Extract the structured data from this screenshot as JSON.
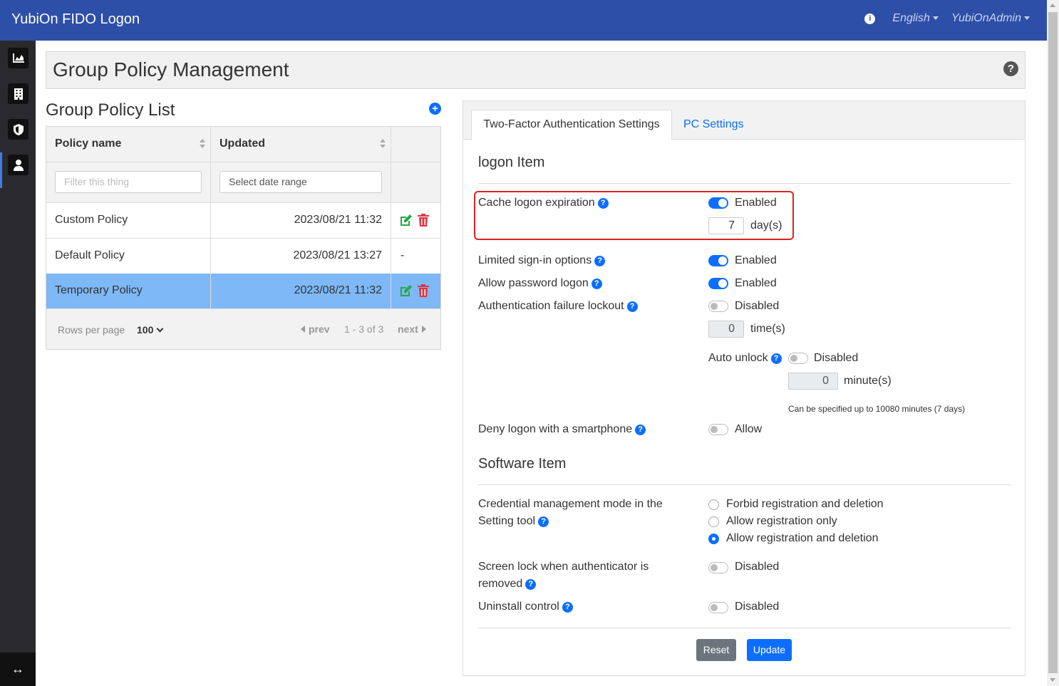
{
  "app": {
    "title": "YubiOn FIDO Logon",
    "info_icon": "info-icon",
    "language": "English",
    "user": "YubiOnAdmin"
  },
  "sidebar": {
    "items": [
      {
        "icon": "chart-icon"
      },
      {
        "icon": "building-icon"
      },
      {
        "icon": "shield-icon",
        "active": true
      },
      {
        "icon": "user-icon"
      }
    ],
    "toggle_icon": "expand-arrows-icon"
  },
  "page": {
    "title": "Group Policy Management",
    "help": "?"
  },
  "list": {
    "title": "Group Policy List",
    "add_icon": "+",
    "columns": [
      "Policy name",
      "Updated"
    ],
    "filter_name_placeholder": "Filter this thing",
    "filter_date_placeholder": "Select date range",
    "rows": [
      {
        "name": "Custom Policy",
        "updated": "2023/08/21 11:32",
        "actions": true
      },
      {
        "name": "Default Policy",
        "updated": "2023/08/21 13:27",
        "actions": false,
        "dash": "-"
      },
      {
        "name": "Temporary Policy",
        "updated": "2023/08/21 11:32",
        "actions": true,
        "selected": true
      }
    ],
    "pager": {
      "rows_label": "Rows per page",
      "rows_value": "100",
      "prev": "prev",
      "range": "1 - 3 of 3",
      "next": "next"
    }
  },
  "settings": {
    "tabs": [
      "Two-Factor Authentication Settings",
      "PC Settings"
    ],
    "logon_section": "logon Item",
    "cache_label": "Cache logon expiration",
    "cache_state": "Enabled",
    "cache_value": "7",
    "cache_unit": "day(s)",
    "limited_label": "Limited sign-in options",
    "limited_state": "Enabled",
    "password_label": "Allow password logon",
    "password_state": "Enabled",
    "lockout_label": "Authentication failure lockout",
    "lockout_state": "Disabled",
    "lockout_value": "0",
    "lockout_unit": "time(s)",
    "auto_unlock_label": "Auto unlock",
    "auto_unlock_state": "Disabled",
    "auto_unlock_value": "0",
    "auto_unlock_unit": "minute(s)",
    "auto_unlock_note": "Can be specified up to 10080 minutes (7 days)",
    "smartphone_label": "Deny logon with a smartphone",
    "smartphone_state": "Allow",
    "software_section": "Software Item",
    "credential_label_1": "Credential management mode in the",
    "credential_label_2": "Setting tool",
    "credential_options": [
      "Forbid registration and deletion",
      "Allow registration only",
      "Allow registration and deletion"
    ],
    "credential_selected": 2,
    "screenlock_label_1": "Screen lock when authenticator is",
    "screenlock_label_2": "removed",
    "screenlock_state": "Disabled",
    "uninstall_label": "Uninstall control",
    "uninstall_state": "Disabled",
    "reset_label": "Reset",
    "update_label": "Update"
  },
  "colors": {
    "navbar": "#2e4fa8",
    "accent": "#0d6efd",
    "selected_row": "#7eb8f7",
    "highlight_border": "#e02020"
  }
}
